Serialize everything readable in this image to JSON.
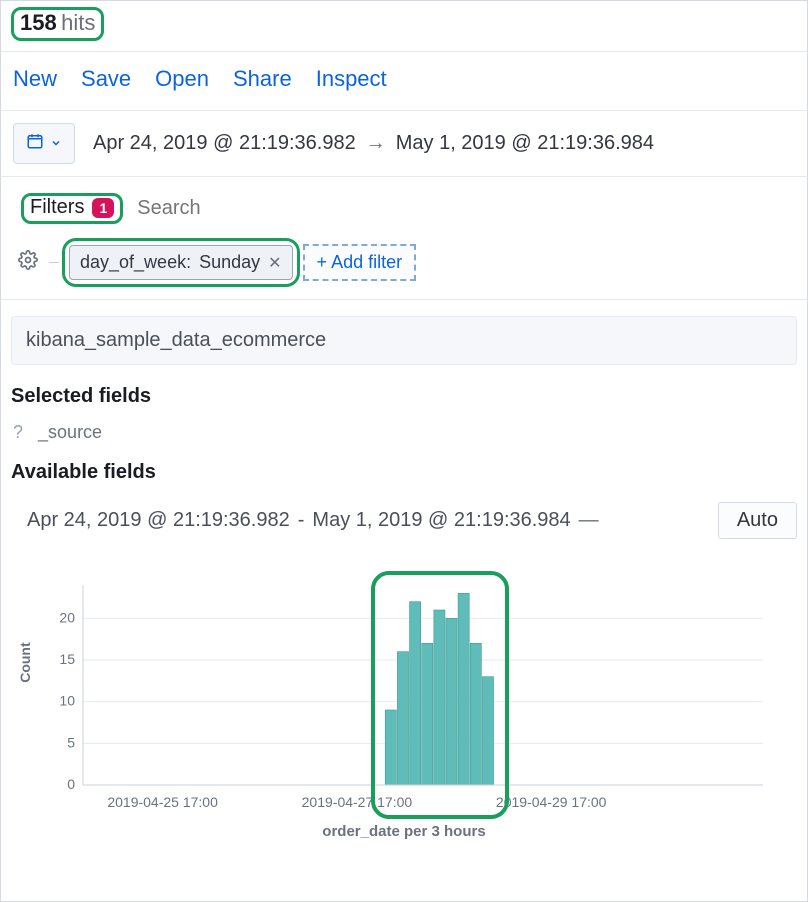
{
  "hits": {
    "count": "158",
    "label": "hits"
  },
  "toolbar": {
    "new": "New",
    "save": "Save",
    "open": "Open",
    "share": "Share",
    "inspect": "Inspect"
  },
  "dateRange": {
    "from": "Apr 24, 2019 @ 21:19:36.982",
    "to": "May 1, 2019 @ 21:19:36.984"
  },
  "filters": {
    "label": "Filters",
    "count": "1",
    "searchPlaceholder": "Search",
    "pill_field": "day_of_week:",
    "pill_value": "Sunday",
    "addFilter": "+ Add filter"
  },
  "indexPattern": "kibana_sample_data_ecommerce",
  "sections": {
    "selected": "Selected fields",
    "available": "Available fields"
  },
  "fields": {
    "sourceQ": "?",
    "sourceName": "_source"
  },
  "chartHeader": {
    "from": "Apr 24, 2019 @ 21:19:36.982",
    "sep": "-",
    "to": "May 1, 2019 @ 21:19:36.984",
    "dash": "—",
    "interval": "Auto"
  },
  "chart": {
    "ylabel": "Count",
    "xlabel": "order_date per 3 hours",
    "xTicks": [
      "2019-04-25 17:00",
      "2019-04-27 17:00",
      "2019-04-29 17:00"
    ]
  },
  "chart_data": {
    "type": "bar",
    "title": "",
    "xlabel": "order_date per 3 hours",
    "ylabel": "Count",
    "ylim": [
      0,
      24
    ],
    "yTicks": [
      0,
      5,
      10,
      15,
      20
    ],
    "xTicks": [
      "2019-04-25 17:00",
      "2019-04-27 17:00",
      "2019-04-29 17:00"
    ],
    "categories": [
      "2019-04-28 00:00",
      "2019-04-28 03:00",
      "2019-04-28 06:00",
      "2019-04-28 09:00",
      "2019-04-28 12:00",
      "2019-04-28 15:00",
      "2019-04-28 18:00",
      "2019-04-28 21:00",
      "2019-04-29 00:00"
    ],
    "values": [
      9,
      16,
      22,
      17,
      21,
      20,
      23,
      17,
      13
    ]
  }
}
